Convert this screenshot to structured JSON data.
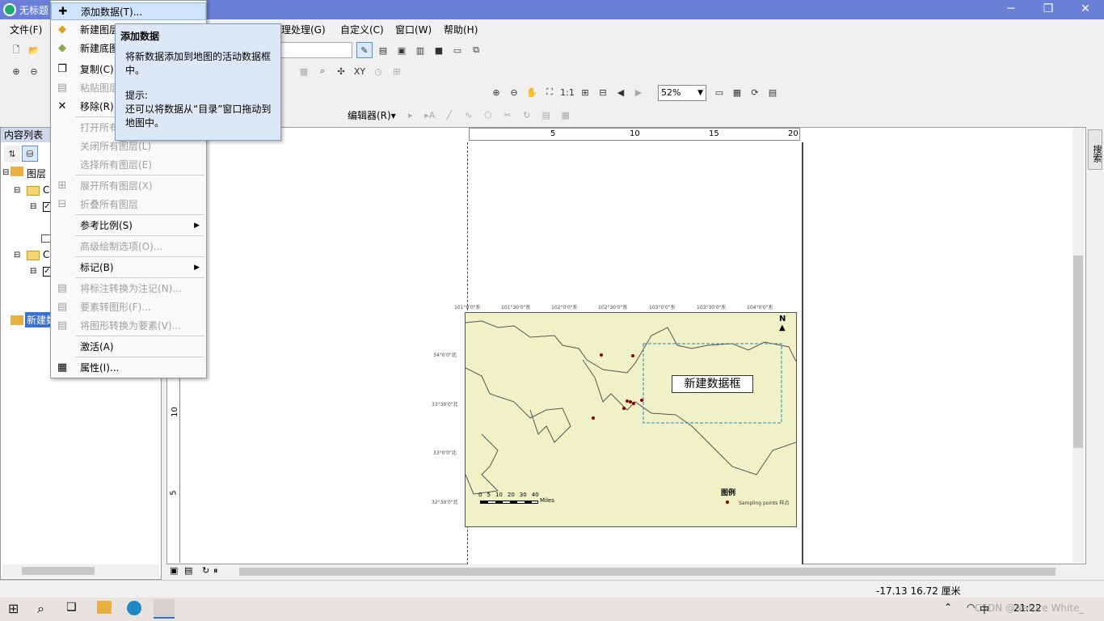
{
  "window": {
    "title": "无标题"
  },
  "menubar": {
    "items": [
      "文件(F)",
      "地理处理(G)",
      "自定义(C)",
      "窗口(W)",
      "帮助(H)"
    ]
  },
  "toolbar": {
    "zoom_value": "52%",
    "editor_label": "编辑器(R)▾"
  },
  "context_menu": {
    "items": [
      {
        "label": "添加数据(T)...",
        "enabled": true,
        "highlighted": true,
        "icon": "add-data-icon"
      },
      {
        "label": "新建图层",
        "enabled": true,
        "icon": "new-layer-icon"
      },
      {
        "label": "新建底图",
        "enabled": true,
        "icon": "new-basemap-icon"
      },
      {
        "label": "复制(C)",
        "enabled": true,
        "icon": "copy-icon"
      },
      {
        "label": "粘贴图层",
        "enabled": false,
        "icon": "paste-icon"
      },
      {
        "label": "移除(R)",
        "enabled": true,
        "icon": "remove-icon"
      },
      {
        "label": "打开所有",
        "enabled": false
      },
      {
        "label": "关闭所有图层(L)",
        "enabled": false
      },
      {
        "label": "选择所有图层(E)",
        "enabled": false
      },
      {
        "label": "展开所有图层(X)",
        "enabled": false,
        "icon": "expand-icon"
      },
      {
        "label": "折叠所有图层",
        "enabled": false,
        "icon": "collapse-icon"
      },
      {
        "label": "参考比例(S)",
        "enabled": true,
        "submenu": true
      },
      {
        "label": "高级绘制选项(O)...",
        "enabled": false
      },
      {
        "label": "标记(B)",
        "enabled": true,
        "submenu": true
      },
      {
        "label": "将标注转换为注记(N)...",
        "enabled": false
      },
      {
        "label": "要素转图形(F)...",
        "enabled": false
      },
      {
        "label": "将图形转换为要素(V)...",
        "enabled": false
      },
      {
        "label": "激活(A)",
        "enabled": true
      },
      {
        "label": "属性(I)...",
        "enabled": true,
        "icon": "properties-icon"
      }
    ]
  },
  "tooltip": {
    "title": "添加数据",
    "body": "将新数据添加到地图的活动数据框中。",
    "hint_label": "提示:",
    "hint": "还可以将数据从“目录”窗口拖动到地图中。"
  },
  "toc": {
    "header": "内容列表",
    "root": "图层",
    "items": [
      "Ca",
      "Ca"
    ],
    "selected": "新建数据框"
  },
  "ruler": {
    "h": [
      "5",
      "10",
      "15",
      "20"
    ],
    "v": [
      "10",
      "5"
    ]
  },
  "map": {
    "dataframe_label": "新建数据框",
    "legend_title": "图例",
    "legend_item": "Sampling points 样点",
    "scalebar_labels": [
      "0",
      "5",
      "10",
      "20",
      "30",
      "40"
    ],
    "scalebar_unit": "Miles",
    "north": "N",
    "top_ticks": [
      "101°0'0\"东",
      "101°30'0\"东",
      "102°0'0\"东",
      "102°30'0\"东",
      "103°0'0\"东",
      "103°30'0\"东",
      "104°0'0\"东"
    ],
    "left_ticks": [
      "34°0'0\"北",
      "33°30'0\"北",
      "33°0'0\"北",
      "32°30'0\"北"
    ],
    "colors": {
      "land": "#f1f1c8",
      "points": "#8b0000",
      "dataframe": "#1e90ff"
    }
  },
  "status": {
    "coords": "-17.13  16.72 厘米"
  },
  "search_panel": {
    "label": "搜索"
  },
  "taskbar": {
    "ime": "中",
    "time": "21:22",
    "watermark": "CSDN @Nature White_"
  }
}
